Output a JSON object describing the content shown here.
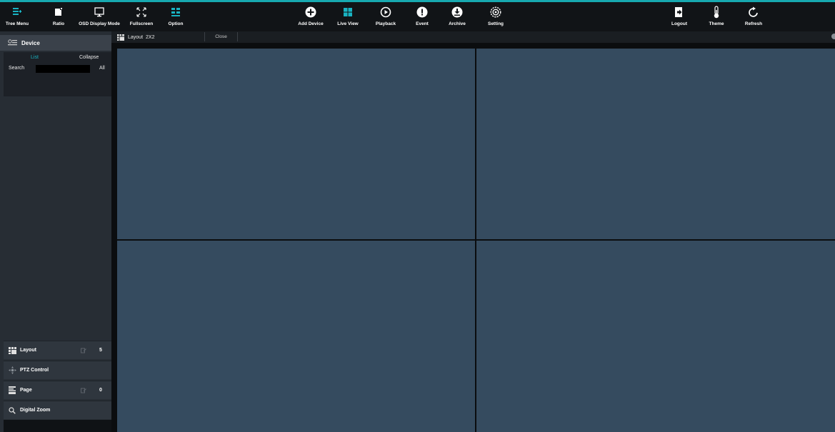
{
  "toolbar": {
    "left": [
      {
        "label": "Tree Menu",
        "icon": "tree-menu-icon"
      },
      {
        "label": "Ratio",
        "icon": "ratio-icon"
      },
      {
        "label": "OSD Display Mode",
        "icon": "osd-display-icon"
      },
      {
        "label": "Fullscreen",
        "icon": "fullscreen-icon"
      },
      {
        "label": "Option",
        "icon": "option-icon"
      }
    ],
    "center": [
      {
        "label": "Add Device",
        "icon": "add-device-icon"
      },
      {
        "label": "Live View",
        "icon": "live-view-icon"
      },
      {
        "label": "Playback",
        "icon": "playback-icon"
      },
      {
        "label": "Event",
        "icon": "event-icon"
      },
      {
        "label": "Archive",
        "icon": "archive-icon"
      },
      {
        "label": "Setting",
        "icon": "setting-icon"
      }
    ],
    "right": [
      {
        "label": "Logout",
        "icon": "logout-icon"
      },
      {
        "label": "Theme",
        "icon": "theme-icon"
      },
      {
        "label": "Refresh",
        "icon": "refresh-icon"
      }
    ]
  },
  "sidebar": {
    "device": {
      "title": "Device",
      "tab_list": "List",
      "tab_collapse": "Collapse",
      "search_label": "Search",
      "search_value": "",
      "search_all": "All"
    },
    "items": [
      {
        "label": "Layout",
        "count": "5"
      },
      {
        "label": "PTZ Control"
      },
      {
        "label": "Page",
        "count": "0"
      },
      {
        "label": "Digital Zoom"
      }
    ]
  },
  "tabbar": {
    "layout_label": "Layout",
    "layout_value": "2X2",
    "close_label": "Close"
  },
  "colors": {
    "accent": "#17a9b0",
    "pane": "#354b5f",
    "toolbar": "#111417",
    "sidebar": "#272d34"
  }
}
